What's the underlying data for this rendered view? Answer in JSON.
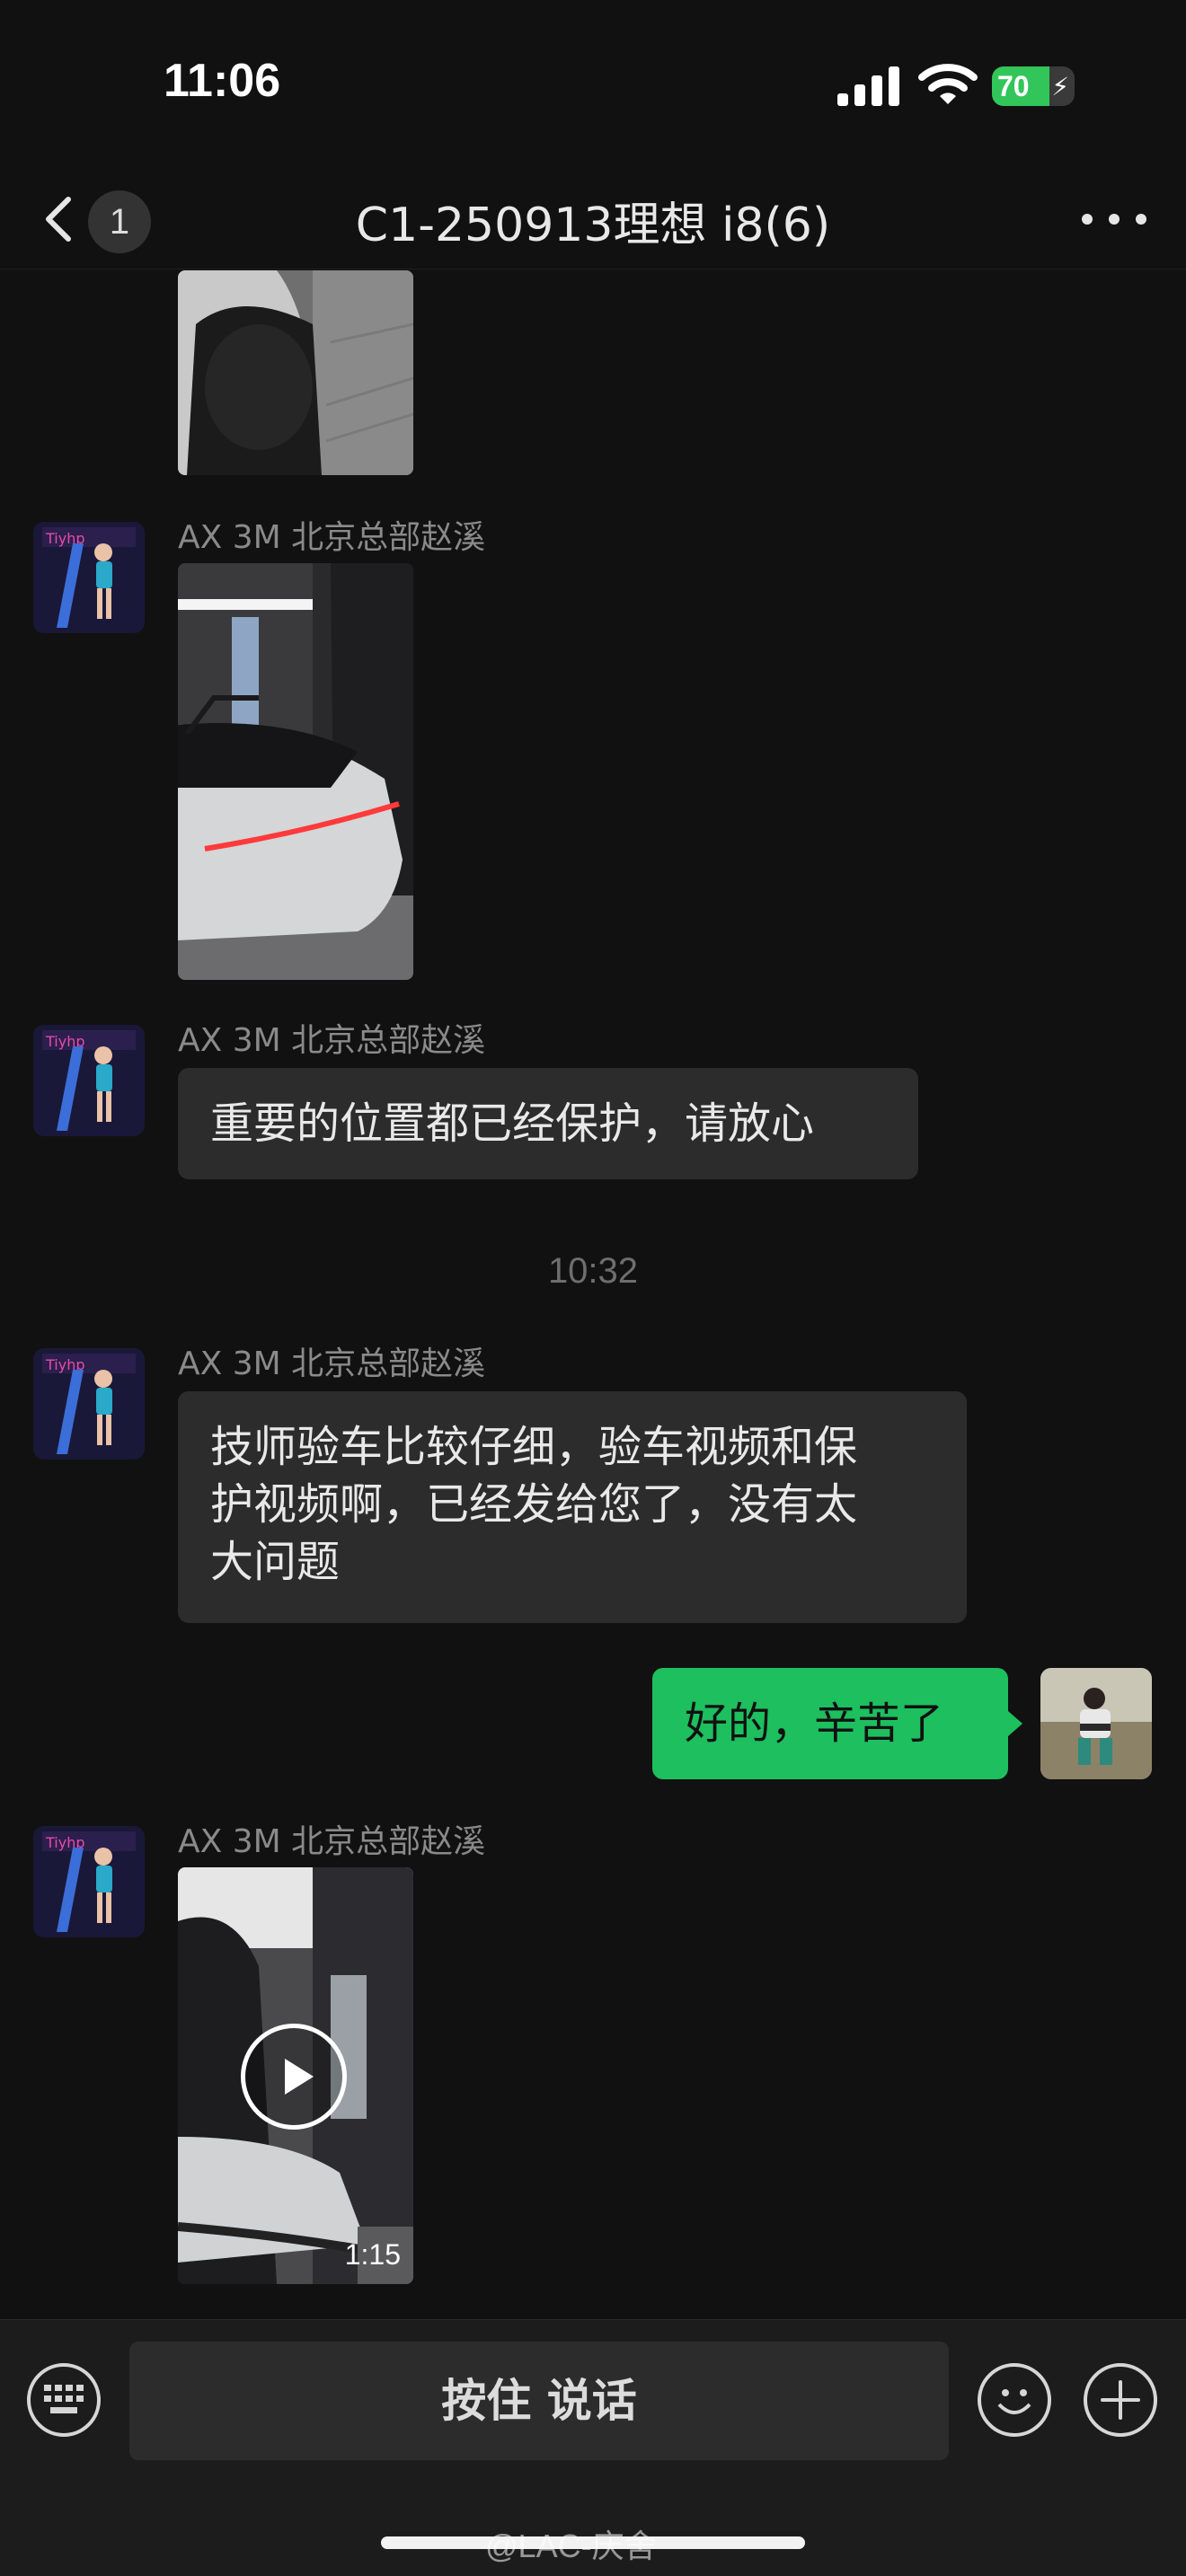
{
  "status_bar": {
    "time": "11:06",
    "battery_level": "70",
    "battery_fraction": 0.7,
    "battery_color": "#32c65a",
    "charging_icon": "bolt-icon"
  },
  "nav": {
    "back_icon": "chevron-left-icon",
    "unread_count": "1",
    "title": "C1-250913理想 i8(6)",
    "more_icon": "more-dots-icon"
  },
  "messages": {
    "sender_name": "AX 3M 北京总部赵溪",
    "msg_text_1": "重要的位置都已经保护，请放心",
    "time_divider": "10:32",
    "msg_text_2_lines": [
      "技师验车比较仔细，验车视频和保",
      "护视频啊，已经发给您了，没有太",
      "大问题"
    ],
    "my_reply": "好的，辛苦了",
    "video_duration": "1:15"
  },
  "input_bar": {
    "keyboard_icon": "keyboard-icon",
    "hold_to_talk": "按住 说话",
    "emoji_icon": "emoji-icon",
    "plus_icon": "plus-icon"
  },
  "watermark": "@LAC-庆舍",
  "colors": {
    "background": "#111111",
    "my_bubble": "#1dbf5e",
    "other_bubble": "#2c2c2c",
    "input_bar": "#1c1c1c"
  }
}
